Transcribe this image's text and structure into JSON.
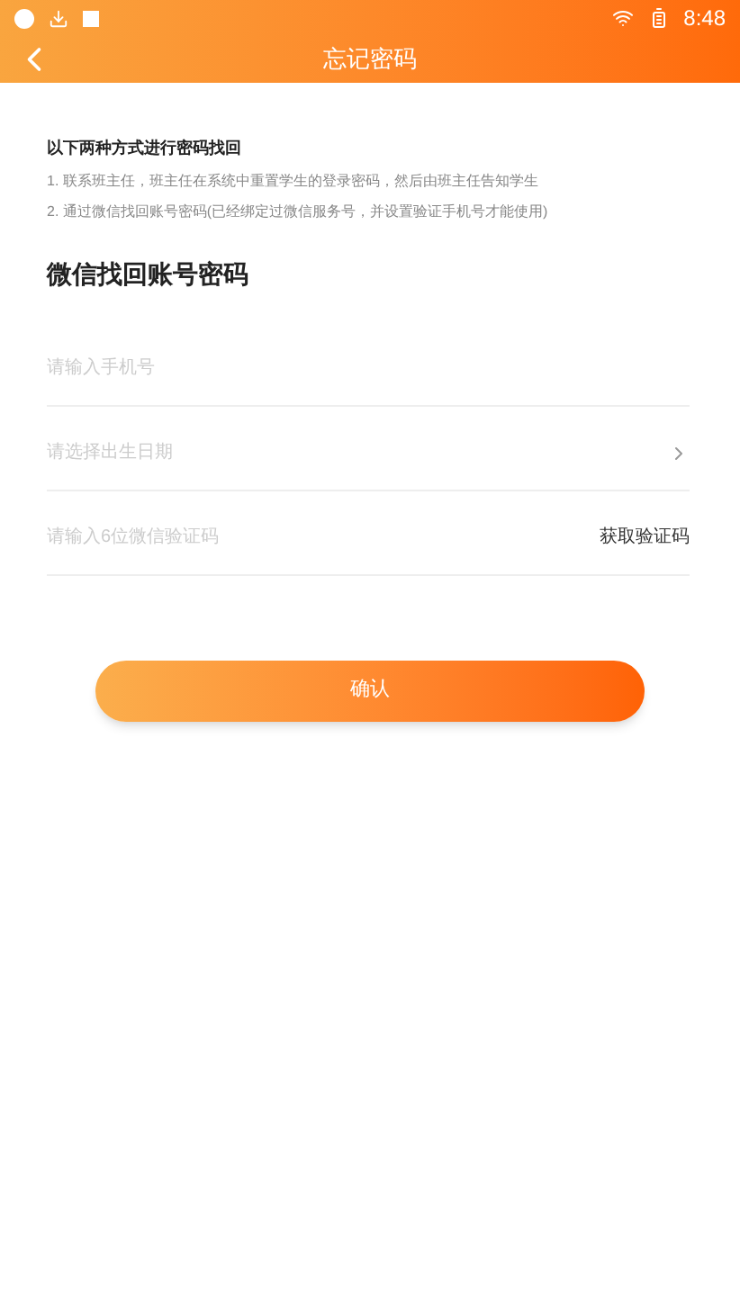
{
  "status_bar": {
    "time": "8:48"
  },
  "header": {
    "title": "忘记密码"
  },
  "intro": {
    "title": "以下两种方式进行密码找回",
    "lines": [
      "1. 联系班主任，班主任在系统中重置学生的登录密码，然后由班主任告知学生",
      "2. 通过微信找回账号密码(已经绑定过微信服务号，并设置验证手机号才能使用)"
    ]
  },
  "section_title": "微信找回账号密码",
  "fields": [
    {
      "kind": "input",
      "placeholder": "请输入手机号"
    },
    {
      "kind": "select",
      "placeholder": "请选择出生日期"
    },
    {
      "kind": "code",
      "placeholder": "请输入6位微信验证码",
      "action": "获取验证码"
    }
  ],
  "confirm_button": "确认"
}
